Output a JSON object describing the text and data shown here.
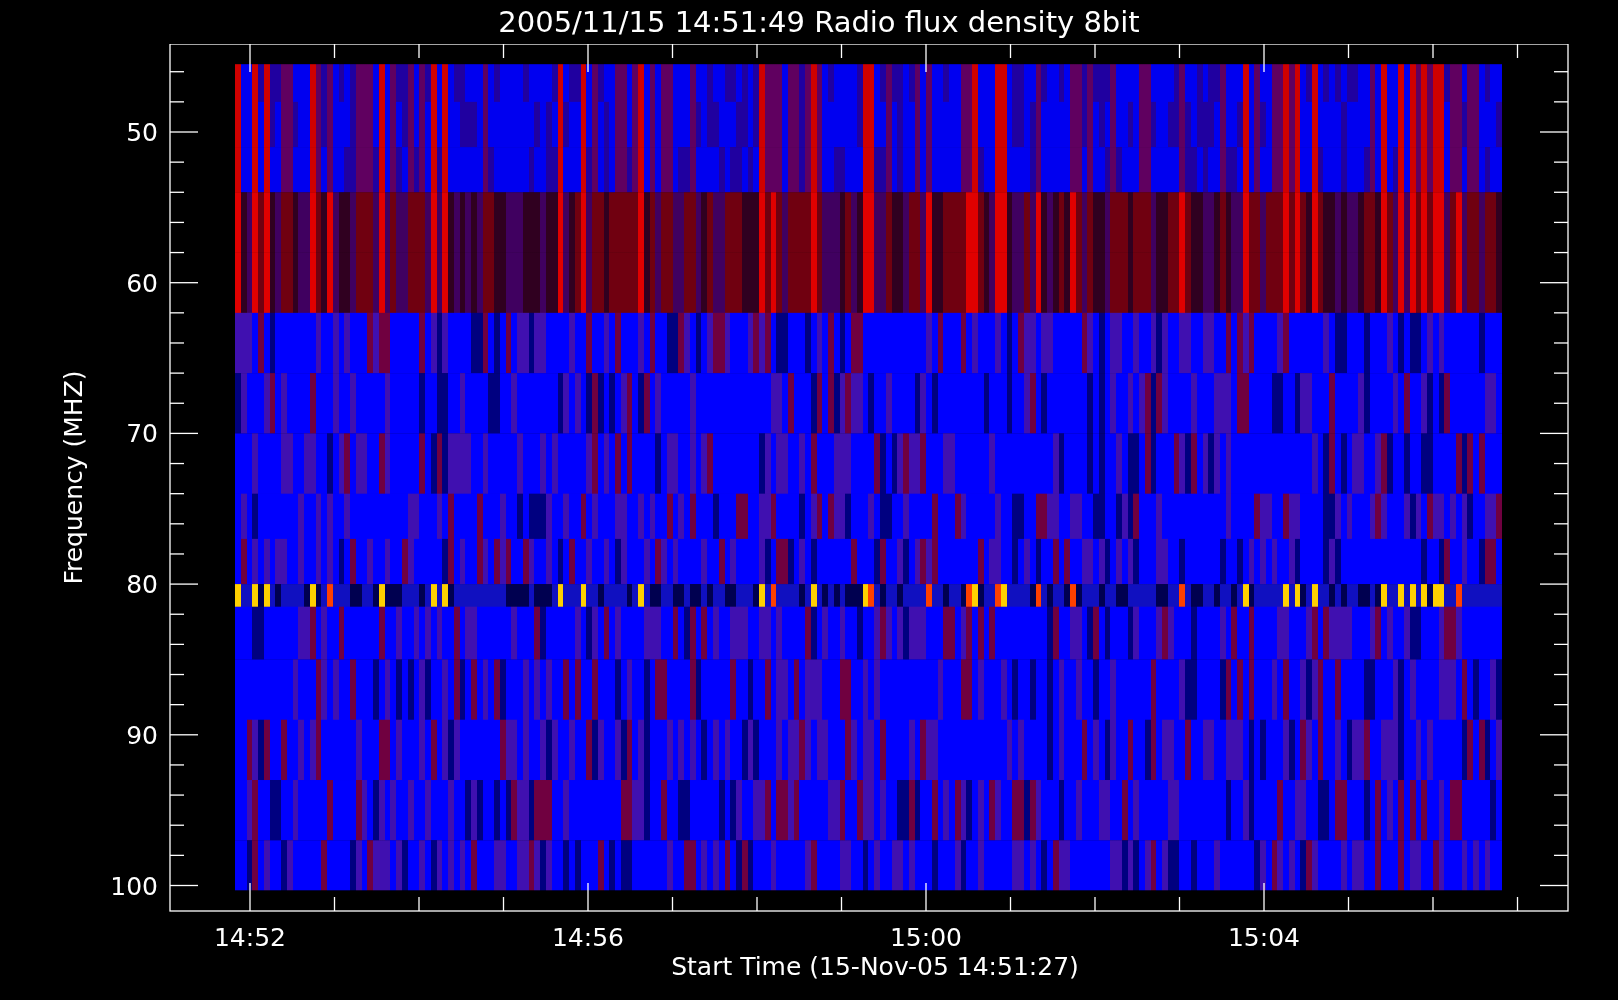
{
  "title": "2005/11/15 14:51:49 Radio flux density 8bit",
  "y_axis": {
    "label": "Frequency (MHZ)",
    "ticks": [
      "50",
      "60",
      "70",
      "80",
      "90",
      "100"
    ]
  },
  "x_axis": {
    "label": "Start Time (15-Nov-05 14:51:27)",
    "ticks": [
      "14:52",
      "14:56",
      "15:00",
      "15:04"
    ]
  }
}
